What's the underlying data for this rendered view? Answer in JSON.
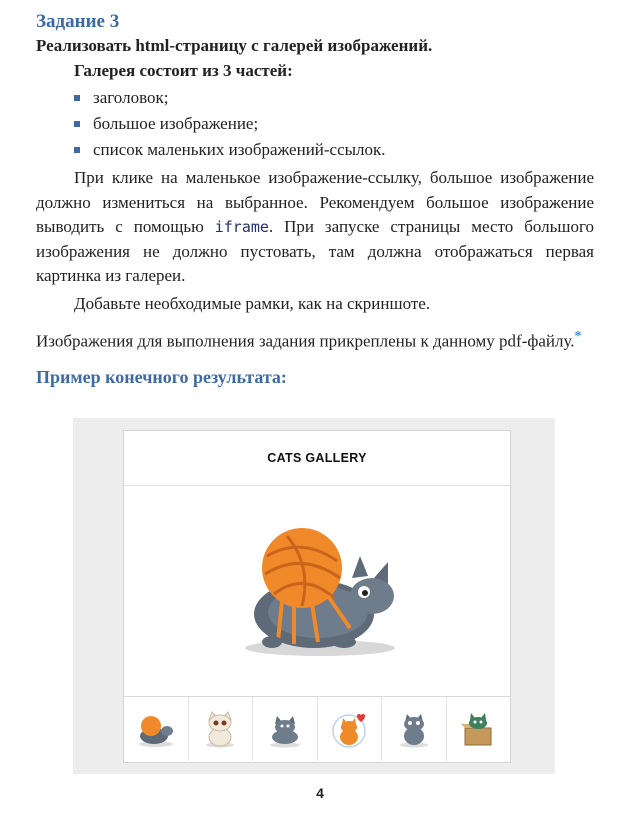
{
  "heading": "Задание 3",
  "subheading": "Реализовать html-страницу с галерей изображений.",
  "parts_title": "Галерея состоит из 3 частей:",
  "parts": [
    "заголовок;",
    "большое изображение;",
    "список маленьких изображений-ссылок."
  ],
  "paragraph1_before_code": "При клике на маленькое изображение-ссылку,  большое изо­бражение должно измениться на выбранное. Рекомендуем большое изображение выводить с помощью ",
  "paragraph1_code": "iframe",
  "paragraph1_after_code": ". При запуске страницы место большого изображения не должно пустовать, там должна отображаться первая картинка из галереи.",
  "paragraph2": "Добавьте необходимые рамки, как на скриншоте.",
  "paragraph3": "Изображения для выполнения задания прикреплены к данному pdf-файлу.",
  "asterisk": "*",
  "example_title": "Пример конечного результата:",
  "gallery": {
    "title": "CATS GALLERY",
    "main_image": "cat-with-yarn-ball",
    "thumbnails": [
      "cat-with-yarn",
      "white-cat",
      "grey-cat-sitting",
      "orange-cat-with-heart",
      "grey-cat-standing",
      "cat-in-box"
    ]
  },
  "page_number": "4",
  "colors": {
    "accent": "#3d6aa6",
    "bullet": "#3d6aa6",
    "asterisk": "#3d8fd6"
  }
}
